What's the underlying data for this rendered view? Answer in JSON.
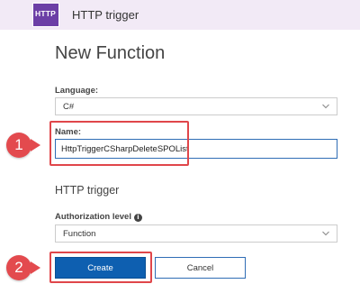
{
  "header": {
    "logo_text": "HTTP",
    "title": "HTTP trigger"
  },
  "page_title": "New Function",
  "language": {
    "label": "Language:",
    "value": "C#"
  },
  "name": {
    "label": "Name:",
    "value": "HttpTriggerCSharpDeleteSPOList"
  },
  "trigger_section": {
    "title": "HTTP trigger",
    "auth_label": "Authorization level",
    "auth_value": "Function"
  },
  "buttons": {
    "create": "Create",
    "cancel": "Cancel"
  },
  "annotations": {
    "step1": "1",
    "step2": "2"
  },
  "colors": {
    "header_bg": "#f2eaf6",
    "logo_bg": "#6c3fa6",
    "primary": "#0e5fb0",
    "annotation": "#e34a4e",
    "input_border": "#2f6db5"
  },
  "icons": {
    "dropdown": "chevron-down-icon",
    "info": "info-icon"
  }
}
